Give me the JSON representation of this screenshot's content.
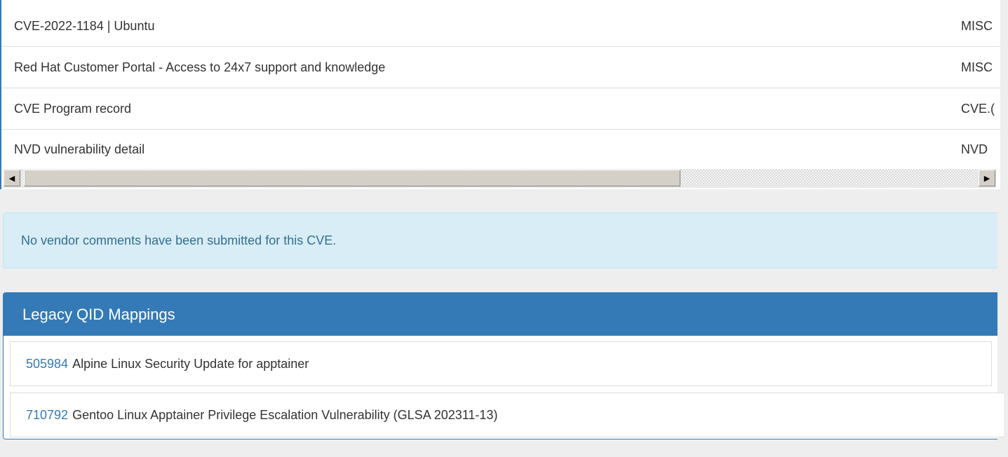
{
  "references": [
    {
      "title": "CVE-2022-1184 | Ubuntu",
      "source": "MISC"
    },
    {
      "title": "Red Hat Customer Portal - Access to 24x7 support and knowledge",
      "source": "MISC"
    },
    {
      "title": "CVE Program record",
      "source": "CVE.("
    },
    {
      "title": "NVD vulnerability detail",
      "source": "NVD"
    }
  ],
  "scrollbar": {
    "left_arrow": "◀",
    "right_arrow": "▶"
  },
  "vendor_comments": {
    "message": "No vendor comments have been submitted for this CVE."
  },
  "legacy_qid": {
    "heading": "Legacy QID Mappings",
    "items": [
      {
        "qid": "505984",
        "title": "Alpine Linux Security Update for apptainer"
      },
      {
        "qid": "710792",
        "title": "Gentoo Linux Apptainer Privilege Escalation Vulnerability (GLSA 202311-13)"
      }
    ]
  }
}
